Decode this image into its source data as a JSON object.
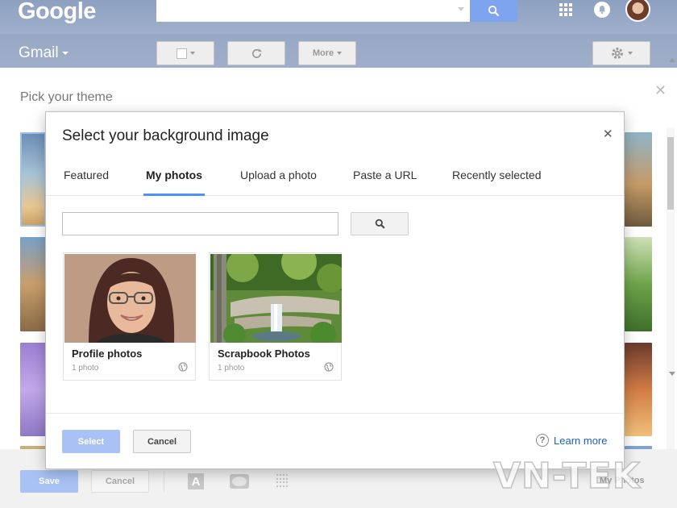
{
  "header": {
    "logo": "Google",
    "product": "Gmail",
    "toolbar": {
      "more_label": "More"
    }
  },
  "theme_panel": {
    "title": "Pick your theme",
    "save_label": "Save",
    "cancel_label": "Cancel",
    "text_icon_glyph": "A",
    "my_photos_label": "My Photos"
  },
  "dialog": {
    "title": "Select your background image",
    "tabs": [
      {
        "label": "Featured",
        "active": false
      },
      {
        "label": "My photos",
        "active": true
      },
      {
        "label": "Upload a photo",
        "active": false
      },
      {
        "label": "Paste a URL",
        "active": false
      },
      {
        "label": "Recently selected",
        "active": false
      }
    ],
    "search": {
      "value": "",
      "placeholder": ""
    },
    "albums": [
      {
        "name": "Profile photos",
        "count": "1 photo"
      },
      {
        "name": "Scrapbook Photos",
        "count": "1 photo"
      }
    ],
    "select_label": "Select",
    "cancel_label": "Cancel",
    "learn_more_label": "Learn more"
  },
  "watermark": "VN-TEK",
  "colors": {
    "accent": "#4d90fe",
    "primary_disabled": "#a9c2f5",
    "link": "#1a5fbd"
  }
}
